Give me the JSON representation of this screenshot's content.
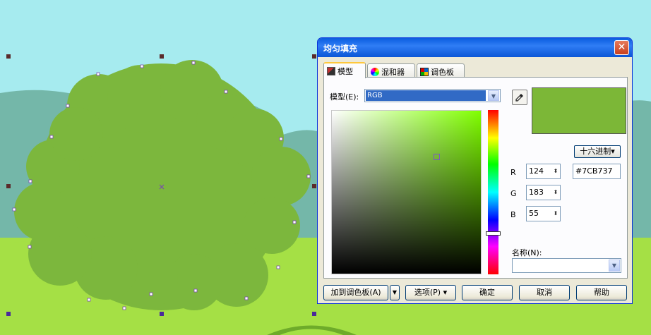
{
  "colors": {
    "sky": "#a6ebef",
    "hills": "#74b7a9",
    "grass": "#a5e045",
    "bush": "#7cb73d",
    "selected_fill": "#7CB737"
  },
  "dialog": {
    "title": "均匀填充",
    "close_icon": "close-x-icon",
    "tabs": [
      {
        "label": "模型",
        "icon": "model-icon",
        "active": true
      },
      {
        "label": "混和器",
        "icon": "mixer-wheel-icon",
        "active": false
      },
      {
        "label": "调色板",
        "icon": "palette-grid-icon",
        "active": false
      }
    ],
    "model_label": "模型(E):",
    "model_value": "RGB",
    "eyedropper_icon": "eyedropper-icon",
    "hue_level": 0.75,
    "saturation": 0.7,
    "brightness": 0.72,
    "hex_format_button": "十六进制▾",
    "channels": [
      {
        "name": "R",
        "value": "124"
      },
      {
        "name": "G",
        "value": "183"
      },
      {
        "name": "B",
        "value": "55"
      }
    ],
    "hex_value": "#7CB737",
    "name_label": "名称(N):",
    "name_value": "",
    "buttons": {
      "add_palette": "加到调色板(A)",
      "options": "选项(P) ▾",
      "ok": "确定",
      "cancel": "取消",
      "help": "帮助"
    }
  }
}
